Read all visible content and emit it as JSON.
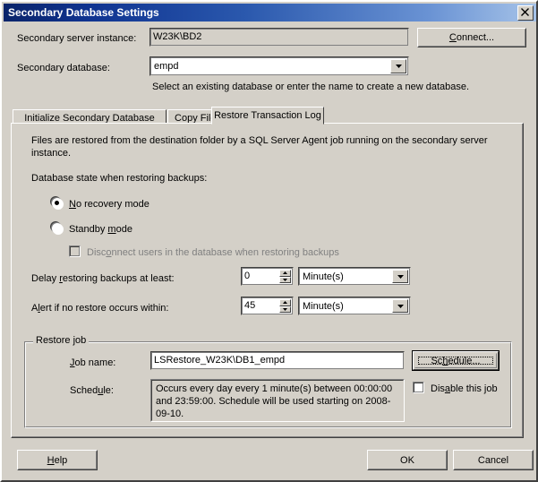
{
  "window": {
    "title": "Secondary Database Settings",
    "close_label": "close-icon"
  },
  "top": {
    "server_instance_label": "Secondary server instance:",
    "server_instance_value": "W23K\\BD2",
    "connect_button": "Connect...",
    "database_label": "Secondary database:",
    "database_value": "empd",
    "database_hint": "Select an existing database or enter the name to create a new database."
  },
  "tabs": [
    {
      "label": "Initialize Secondary Database",
      "selected": false
    },
    {
      "label": "Copy Files",
      "selected": false
    },
    {
      "label": "Restore Transaction Log",
      "selected": true
    }
  ],
  "restore_tab": {
    "description": "Files are restored from the destination folder by a SQL Server Agent job running on the secondary server instance.",
    "state_label": "Database state when restoring backups:",
    "radio_no_recovery": "No recovery mode",
    "radio_standby": "Standby mode",
    "checkbox_disconnect": "Disconnect users in the database when restoring backups",
    "delay_label": "Delay restoring backups at least:",
    "delay_value": "0",
    "delay_unit": "Minute(s)",
    "alert_label": "Alert if no restore occurs within:",
    "alert_value": "45",
    "alert_unit": "Minute(s)",
    "group_title": "Restore job",
    "job_name_label": "Job name:",
    "job_name_value": "LSRestore_W23K\\DB1_empd",
    "schedule_label": "Schedule:",
    "schedule_value": "Occurs every day every 1 minute(s) between 00:00:00 and 23:59:00. Schedule will be used starting on 2008-09-10.",
    "schedule_button": "Schedule...",
    "disable_job_checkbox": "Disable this job"
  },
  "footer": {
    "help": "Help",
    "ok": "OK",
    "cancel": "Cancel"
  },
  "colors": {
    "face": "#d4d0c8",
    "title_left": "#0a246a",
    "title_right": "#a6c3e8",
    "disabled_text": "#808080"
  }
}
